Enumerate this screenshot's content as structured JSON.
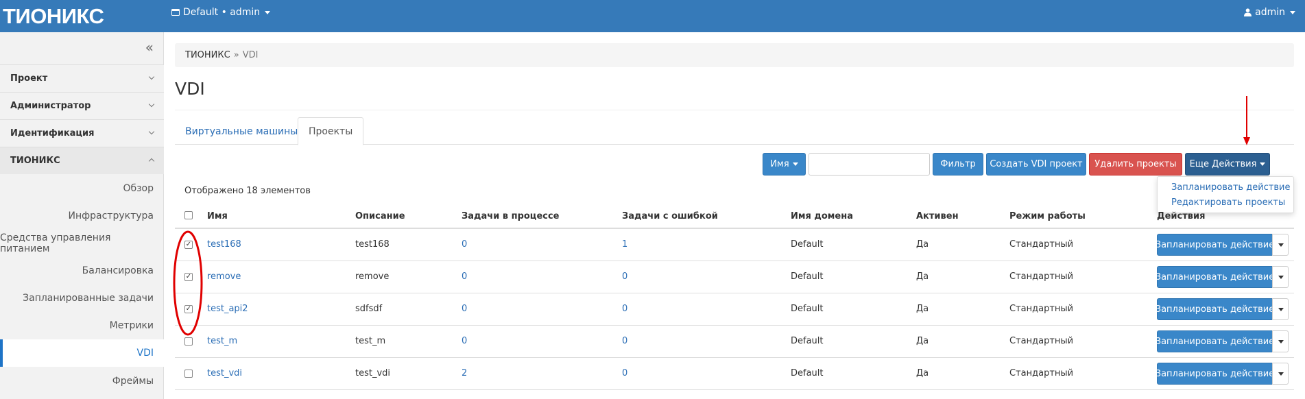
{
  "topbar": {
    "logo": "ТИОНИКС",
    "project_selector": "Default • admin",
    "user": "admin"
  },
  "sidebar": {
    "sections": [
      {
        "label": "Проект"
      },
      {
        "label": "Администратор"
      },
      {
        "label": "Идентификация"
      },
      {
        "label": "ТИОНИКС"
      }
    ],
    "subitems": [
      {
        "label": "Обзор"
      },
      {
        "label": "Инфраструктура"
      },
      {
        "label": "Средства управления питанием"
      },
      {
        "label": "Балансировка"
      },
      {
        "label": "Запланированные задачи"
      },
      {
        "label": "Метрики"
      },
      {
        "label": "VDI"
      },
      {
        "label": "Фреймы"
      }
    ]
  },
  "breadcrumb": {
    "root": "ТИОНИКС",
    "sep": "»",
    "current": "VDI"
  },
  "page_title": "VDI",
  "tabs": [
    {
      "label": "Виртуальные машины"
    },
    {
      "label": "Проекты"
    }
  ],
  "toolbar": {
    "filter_field": "Имя",
    "search_placeholder": "",
    "filter_button": "Фильтр",
    "create_button": "Создать VDI проект",
    "delete_button": "Удалить проекты",
    "more_button": "Еще Действия"
  },
  "more_menu": {
    "items": [
      "Запланировать действие",
      "Редактировать проекты"
    ]
  },
  "count_text": "Отображено 18 элементов",
  "table": {
    "headers": {
      "name": "Имя",
      "description": "Описание",
      "tasks_in_progress": "Задачи в процессе",
      "tasks_error": "Задачи с ошибкой",
      "domain": "Имя домена",
      "active": "Активен",
      "mode": "Режим работы",
      "actions": "Действия"
    },
    "rows": [
      {
        "checked": true,
        "name": "test168",
        "description": "test168",
        "in_progress": "0",
        "errors": "1",
        "domain": "Default",
        "active": "Да",
        "mode": "Стандартный",
        "action": "Запланировать действие"
      },
      {
        "checked": true,
        "name": "remove",
        "description": "remove",
        "in_progress": "0",
        "errors": "0",
        "domain": "Default",
        "active": "Да",
        "mode": "Стандартный",
        "action": "Запланировать действие"
      },
      {
        "checked": true,
        "name": "test_api2",
        "description": "sdfsdf",
        "in_progress": "0",
        "errors": "0",
        "domain": "Default",
        "active": "Да",
        "mode": "Стандартный",
        "action": "Запланировать действие"
      },
      {
        "checked": false,
        "name": "test_m",
        "description": "test_m",
        "in_progress": "0",
        "errors": "0",
        "domain": "Default",
        "active": "Да",
        "mode": "Стандартный",
        "action": "Запланировать действие"
      },
      {
        "checked": false,
        "name": "test_vdi",
        "description": "test_vdi",
        "in_progress": "2",
        "errors": "0",
        "domain": "Default",
        "active": "Да",
        "mode": "Стандартный",
        "action": "Запланировать действие"
      }
    ]
  },
  "colors": {
    "topbar": "#367ab9",
    "link": "#2a6db5",
    "primary_button": "#3a87c9",
    "danger_button": "#d9534f",
    "dark_button": "#2c5f91",
    "annotation": "#e00000"
  }
}
